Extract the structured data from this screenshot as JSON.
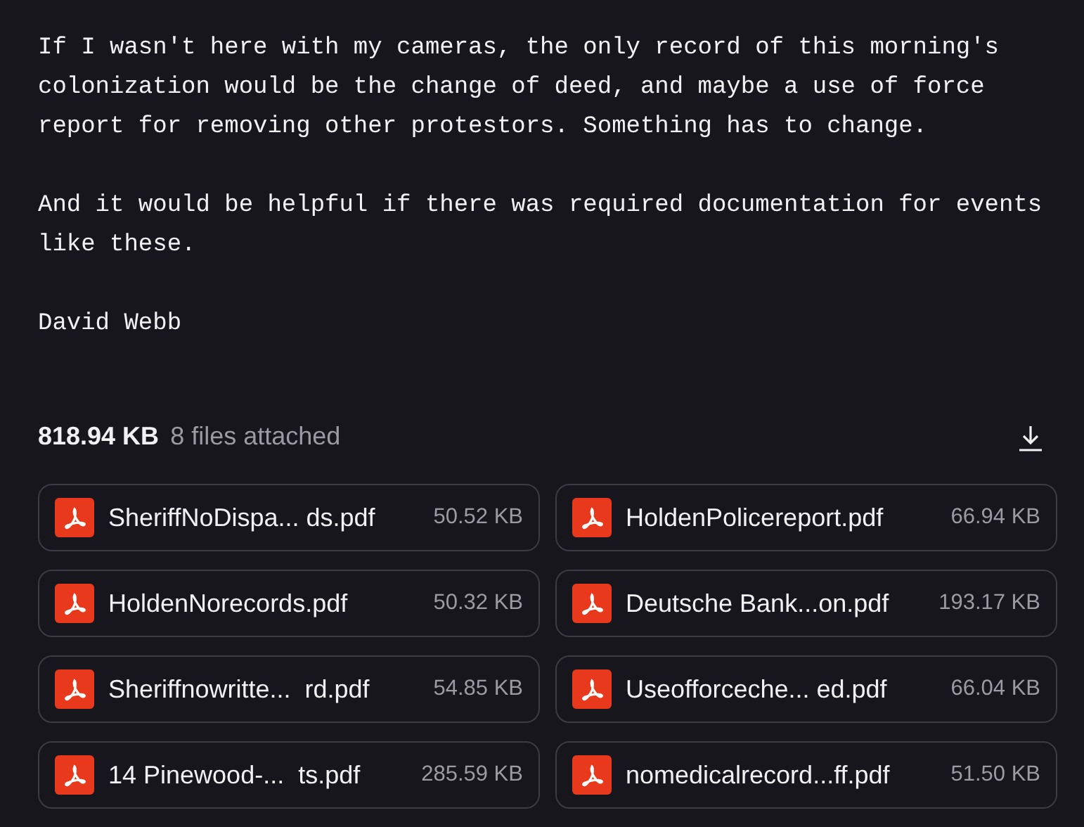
{
  "message": {
    "paragraphs": [
      {
        "lines": [
          "If I wasn't here with my cameras, the only record of this morning's",
          "colonization would be the change of deed, and maybe a use of force",
          "report for removing other protestors. Something has to change."
        ]
      },
      {
        "lines": [
          "And it would be helpful if there was required documentation for events",
          "like these."
        ]
      },
      {
        "lines": [
          "David Webb"
        ]
      }
    ]
  },
  "attachments": {
    "total_size": "818.94 KB",
    "count_label": "8 files attached",
    "files": [
      {
        "name": "SheriffNoDispa... ds.pdf",
        "size": "50.52 KB"
      },
      {
        "name": "HoldenPolicereport.pdf",
        "size": "66.94 KB"
      },
      {
        "name": "HoldenNorecords.pdf",
        "size": "50.32 KB"
      },
      {
        "name": "Deutsche Bank...on.pdf",
        "size": "193.17 KB"
      },
      {
        "name": "Sheriffnowritte...  rd.pdf",
        "size": "54.85 KB"
      },
      {
        "name": "Useofforceche... ed.pdf",
        "size": "66.04 KB"
      },
      {
        "name": "14 Pinewood-...  ts.pdf",
        "size": "285.59 KB"
      },
      {
        "name": "nomedicalrecord...ff.pdf",
        "size": "51.50 KB"
      }
    ]
  }
}
